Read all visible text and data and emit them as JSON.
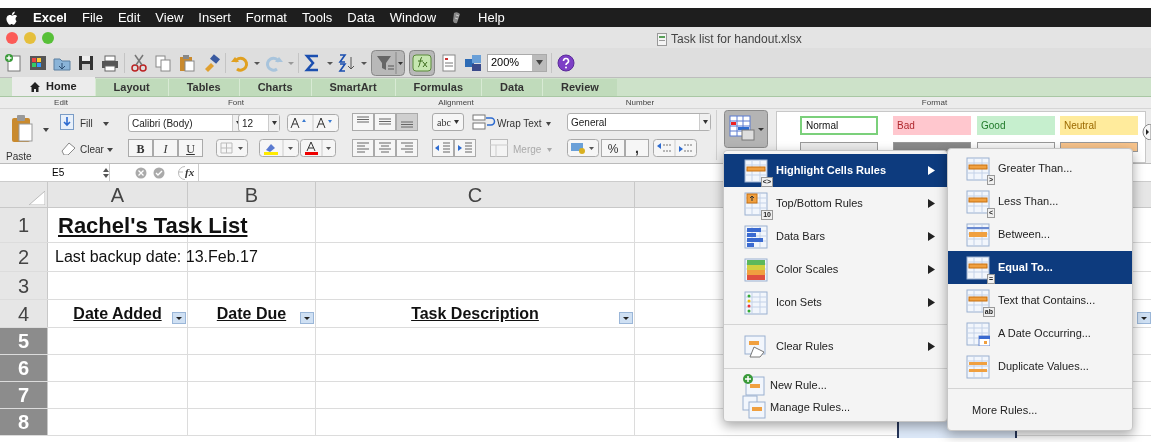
{
  "menu_bar": {
    "items": [
      {
        "label": "Excel",
        "bold": true
      },
      {
        "label": "File",
        "bold": false
      },
      {
        "label": "Edit",
        "bold": false
      },
      {
        "label": "View",
        "bold": false
      },
      {
        "label": "Insert",
        "bold": false
      },
      {
        "label": "Format",
        "bold": false
      },
      {
        "label": "Tools",
        "bold": false
      },
      {
        "label": "Data",
        "bold": false
      },
      {
        "label": "Window",
        "bold": false
      },
      {
        "label": "Help",
        "bold": false
      }
    ]
  },
  "window": {
    "title": "Task list for handout.xlsx"
  },
  "toolbar": {
    "zoom": "200%"
  },
  "ribbon": {
    "tabs": [
      {
        "label": "Home",
        "selected": true
      },
      {
        "label": "Layout",
        "selected": false
      },
      {
        "label": "Tables",
        "selected": false
      },
      {
        "label": "Charts",
        "selected": false
      },
      {
        "label": "SmartArt",
        "selected": false
      },
      {
        "label": "Formulas",
        "selected": false
      },
      {
        "label": "Data",
        "selected": false
      },
      {
        "label": "Review",
        "selected": false
      }
    ],
    "groups": [
      "Edit",
      "Font",
      "Alignment",
      "Number",
      "Format"
    ],
    "edit": {
      "paste": "Paste",
      "fill": "Fill",
      "clear": "Clear"
    },
    "font": {
      "name": "Calibri (Body)",
      "size": "12",
      "bold": "B",
      "italic": "I",
      "underline": "U"
    },
    "alignment": {
      "orientation": "abc",
      "wrap": "Wrap Text",
      "merge": {
        "label": "Merge",
        "disabled": true
      }
    },
    "number": {
      "format": "General",
      "percent": "%",
      "comma": ","
    },
    "styles": [
      {
        "label": "Normal",
        "color": "#ffffff"
      },
      {
        "label": "Bad",
        "color": "#ffc7ce"
      },
      {
        "label": "Good",
        "color": "#c6efce"
      },
      {
        "label": "Neutral",
        "color": "#ffeb9c"
      }
    ]
  },
  "formula_bar": {
    "cell": "E5",
    "fx": "fx"
  },
  "sheet": {
    "columns": [
      "A",
      "B",
      "C"
    ],
    "rows": [
      {
        "number": "1",
        "selected": false,
        "kind": "title",
        "cells": [
          "Rachel's Task List"
        ]
      },
      {
        "number": "2",
        "selected": false,
        "kind": "note",
        "cells": [
          "Last backup date: 13.Feb.17"
        ]
      },
      {
        "number": "3",
        "selected": false,
        "kind": "blank",
        "cells": []
      },
      {
        "number": "4",
        "selected": false,
        "kind": "header",
        "cells": [
          "Date Added",
          "Date Due",
          "Task Description"
        ]
      },
      {
        "number": "5",
        "selected": true,
        "kind": "blank",
        "cells": []
      },
      {
        "number": "6",
        "selected": true,
        "kind": "blank",
        "cells": []
      },
      {
        "number": "7",
        "selected": true,
        "kind": "blank",
        "cells": []
      },
      {
        "number": "8",
        "selected": true,
        "kind": "blank",
        "cells": []
      }
    ]
  },
  "context_menu": {
    "items": [
      {
        "kind": "item",
        "label": "Highlight Cells Rules",
        "badge": "<>",
        "submenu": true,
        "selected": true
      },
      {
        "kind": "item",
        "label": "Top/Bottom Rules",
        "badge": "10",
        "submenu": true,
        "selected": false
      },
      {
        "kind": "item",
        "label": "Data Bars",
        "submenu": true,
        "selected": false
      },
      {
        "kind": "item",
        "label": "Color Scales",
        "submenu": true,
        "selected": false
      },
      {
        "kind": "item",
        "label": "Icon Sets",
        "submenu": true,
        "selected": false
      },
      {
        "kind": "divider"
      },
      {
        "kind": "item",
        "label": "Clear Rules",
        "submenu": true,
        "selected": false
      },
      {
        "kind": "divider"
      },
      {
        "kind": "small",
        "label": "New Rule...",
        "submenu": false,
        "selected": false
      },
      {
        "kind": "small",
        "label": "Manage Rules...",
        "submenu": false,
        "selected": false
      }
    ]
  },
  "submenu": {
    "items": [
      {
        "kind": "item",
        "label": "Greater Than...",
        "badge": ">",
        "selected": false
      },
      {
        "kind": "item",
        "label": "Less Than...",
        "badge": "<",
        "selected": false
      },
      {
        "kind": "item",
        "label": "Between...",
        "selected": false
      },
      {
        "kind": "item",
        "label": "Equal To...",
        "badge": "=",
        "selected": true
      },
      {
        "kind": "item",
        "label": "Text that Contains...",
        "badge": "ab",
        "selected": false
      },
      {
        "kind": "item",
        "label": "A Date Occurring...",
        "selected": false
      },
      {
        "kind": "item",
        "label": "Duplicate Values...",
        "selected": false
      },
      {
        "kind": "divider"
      },
      {
        "kind": "plain",
        "label": "More Rules...",
        "selected": false
      }
    ]
  }
}
